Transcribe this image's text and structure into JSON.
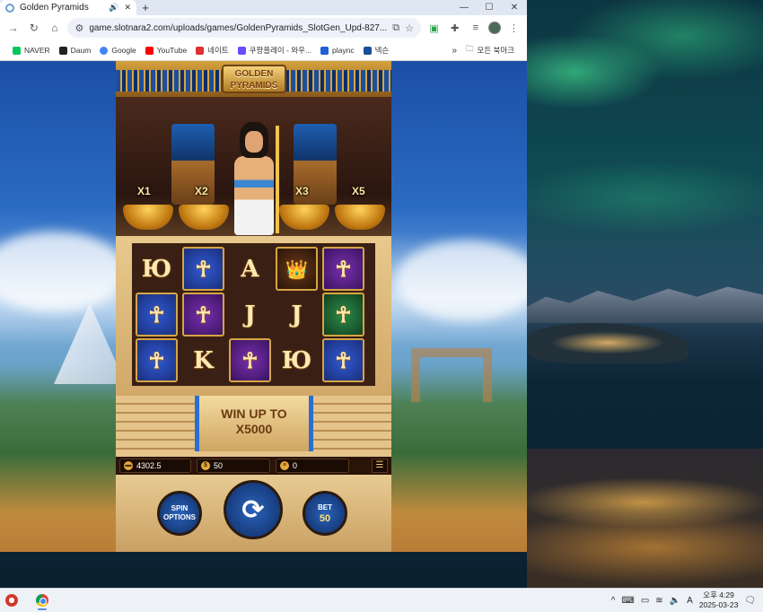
{
  "browser": {
    "tab_title": "Golden Pyramids",
    "new_tab_label": "+",
    "url": "game.slotnara2.com/uploads/games/GoldenPyramids_SlotGen_Upd-827...",
    "window_controls": [
      "—",
      "☐",
      "✕"
    ]
  },
  "bookmarks": [
    {
      "label": "NAVER",
      "color": "#03c75a"
    },
    {
      "label": "Daum",
      "color": "#222222"
    },
    {
      "label": "Google",
      "color": "#4285f4"
    },
    {
      "label": "YouTube",
      "color": "#ff0000"
    },
    {
      "label": "네이트",
      "color": "#e03030"
    },
    {
      "label": "쿠팡플레이 - 와우...",
      "color": "#6a4cff"
    },
    {
      "label": "plaync",
      "color": "#1f5fd6"
    },
    {
      "label": "넥슨",
      "color": "#1b4d9b"
    }
  ],
  "bookmarks_more": "»",
  "bookmarks_folder": "모든 북마크",
  "game": {
    "logo_line1": "GOLDEN",
    "logo_line2": "PYRAMIDS",
    "multipliers": [
      "X1",
      "X2",
      "X3",
      "X5"
    ],
    "reels": [
      [
        "Ю",
        "☥",
        "A",
        "👑",
        "☥"
      ],
      [
        "☥",
        "☥",
        "J",
        "J",
        "☥"
      ],
      [
        "☥",
        "K",
        "☥",
        "Ю",
        "☥"
      ]
    ],
    "win_line1": "WIN UP TO",
    "win_line2": "X5000",
    "balance": "4302.5",
    "bet_display": "50",
    "win_display": "0",
    "spin_options_line1": "SPIN",
    "spin_options_line2": "OPTIONS",
    "spin_symbol": "⟳",
    "bet_label": "BET",
    "bet_value": "50",
    "menu_symbol": "☰"
  },
  "taskbar": {
    "time_period": "오후 4:29",
    "date": "2025-03-23",
    "tray_icons": [
      "^",
      "⌨",
      "A"
    ]
  }
}
